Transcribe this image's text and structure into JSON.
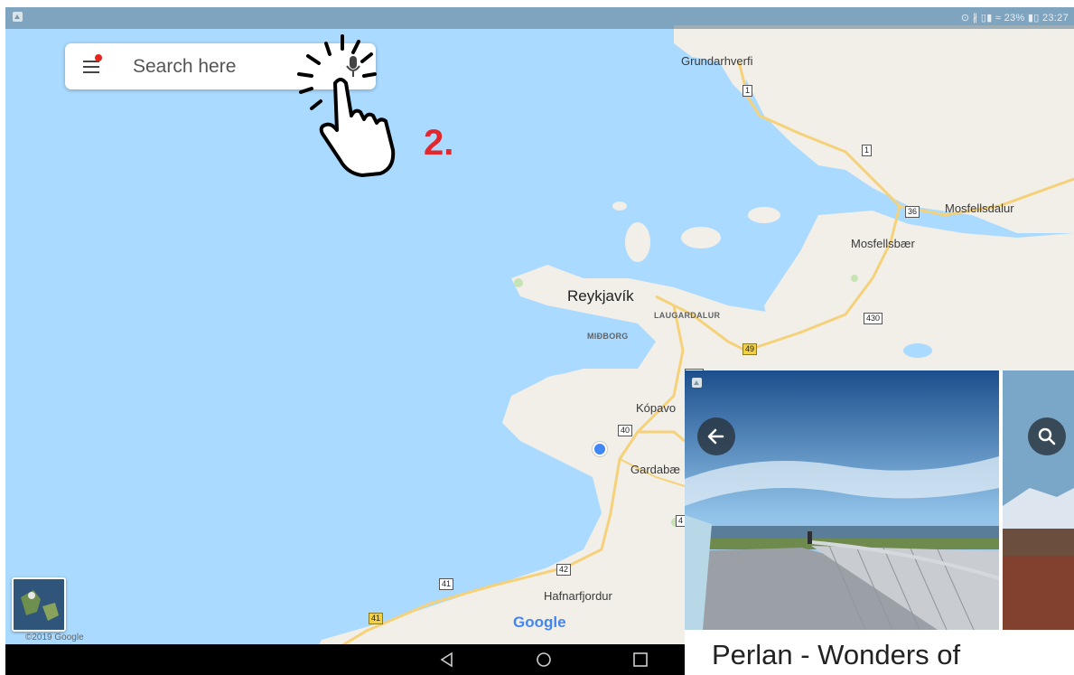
{
  "status_bar": {
    "right_text": "⊙ ∦ ▯▮ ≈ 23% ▮▯ 23:27"
  },
  "search": {
    "placeholder": "Search here"
  },
  "annotation": {
    "step_label": "2."
  },
  "map": {
    "places": {
      "grundarhverfi": "Grundarhverfi",
      "mosfellsdalur": "Mosfellsdalur",
      "mosfellsbaer": "Mosfellsbær",
      "reykjavik": "Reykjavík",
      "laugardalur": "LAUGARDALUR",
      "midborg": "MIÐBORG",
      "kopavogur": "Kópavo",
      "gardabaer": "Gardabæ",
      "hafnarfjordur": "Hafnarfjordur"
    },
    "roads": {
      "r1a": "1",
      "r1b": "1",
      "r36": "36",
      "r430": "430",
      "r49": "49",
      "r413": "413",
      "r40": "40",
      "r42": "42",
      "r41a": "41",
      "r41b": "41",
      "r4x": "4"
    },
    "attribution": "Google",
    "copyright": "©2019 Google"
  },
  "place_panel": {
    "title": "Perlan - Wonders of"
  },
  "colors": {
    "water": "#aadaff",
    "land": "#f2efe9",
    "road": "#f5d27a",
    "accent_red": "#e0282e",
    "location_blue": "#4285f4"
  },
  "icons": {
    "menu": "menu-icon",
    "mic": "mic-icon",
    "pointer": "tap-hand-icon",
    "back": "arrow-left-icon",
    "search": "search-icon",
    "nav_back": "triangle-back-icon",
    "nav_home": "circle-home-icon",
    "nav_recent": "square-recent-icon"
  }
}
